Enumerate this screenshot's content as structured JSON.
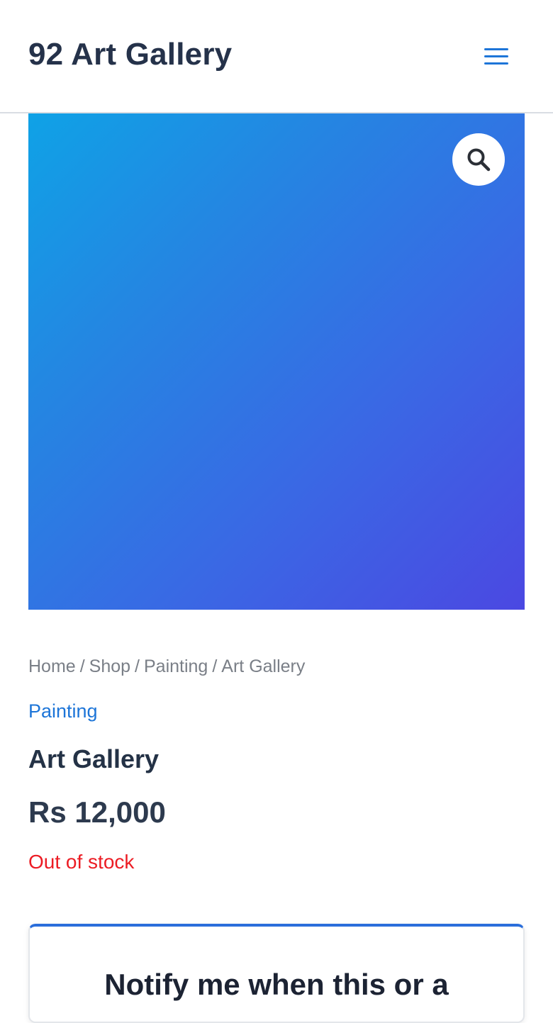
{
  "header": {
    "site_title": "92 Art Gallery",
    "menu_icon": "hamburger-menu-icon"
  },
  "product_image": {
    "gradient_colors": [
      "#0fa2e6",
      "#2486e2",
      "#3a68e4",
      "#4b48e2"
    ],
    "zoom_icon": "magnifier-icon"
  },
  "breadcrumb": {
    "items": [
      "Home",
      "Shop",
      "Painting",
      "Art Gallery"
    ],
    "separator": "/"
  },
  "product": {
    "category": "Painting",
    "title": "Art Gallery",
    "price": "Rs 12,000",
    "stock_status": "Out of stock"
  },
  "notify": {
    "heading": "Notify me when this or a"
  },
  "colors": {
    "accent": "#1d75d8",
    "text_dark": "#243246",
    "muted": "#7a7f87",
    "out_of_stock": "#ec1c24",
    "card_top_border": "#2a6edb"
  }
}
